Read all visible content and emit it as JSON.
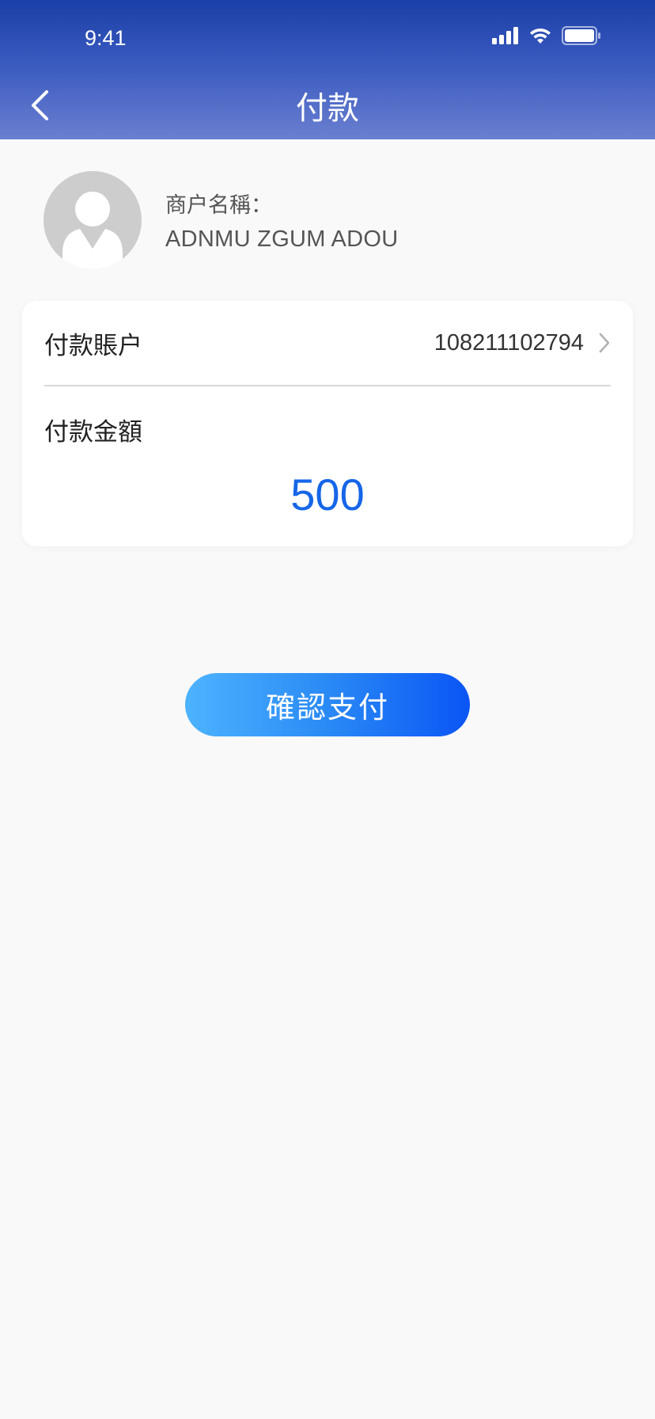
{
  "status_bar": {
    "time": "9:41",
    "icons": [
      "signal-icon",
      "wifi-icon",
      "battery-icon"
    ]
  },
  "nav": {
    "back_icon": "chevron-left-icon",
    "title": "付款"
  },
  "merchant": {
    "avatar_icon": "user-avatar-icon",
    "label": "商户名稱：",
    "name": "ADNMU ZGUM ADOU"
  },
  "payment_card": {
    "account_label": "付款賬户",
    "account_number": "108211102794",
    "account_chevron_icon": "chevron-right-icon",
    "amount_label": "付款金額",
    "amount_value": "500"
  },
  "confirm_button": {
    "label": "確認支付"
  },
  "colors": {
    "header_top": "#1a3fa6",
    "header_bottom": "#6a7fd0",
    "amount": "#1565e8",
    "button_start": "#4db3ff",
    "button_end": "#0a55f5",
    "background": "#f9f9f9"
  }
}
